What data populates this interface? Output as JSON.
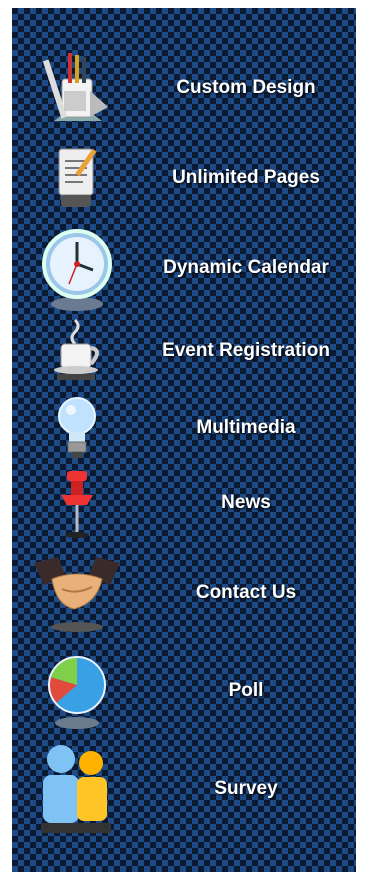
{
  "menu": {
    "items": [
      {
        "label": "Custom Design",
        "icon": "pencil-cup-icon"
      },
      {
        "label": "Unlimited Pages",
        "icon": "notepad-icon"
      },
      {
        "label": "Dynamic Calendar",
        "icon": "clock-icon"
      },
      {
        "label": "Event Registration",
        "icon": "coffee-cup-icon"
      },
      {
        "label": "Multimedia",
        "icon": "lightbulb-icon"
      },
      {
        "label": "News",
        "icon": "pushpin-icon"
      },
      {
        "label": "Contact Us",
        "icon": "handshake-icon"
      },
      {
        "label": "Poll",
        "icon": "pie-chart-icon"
      },
      {
        "label": "Survey",
        "icon": "people-icon"
      }
    ]
  }
}
